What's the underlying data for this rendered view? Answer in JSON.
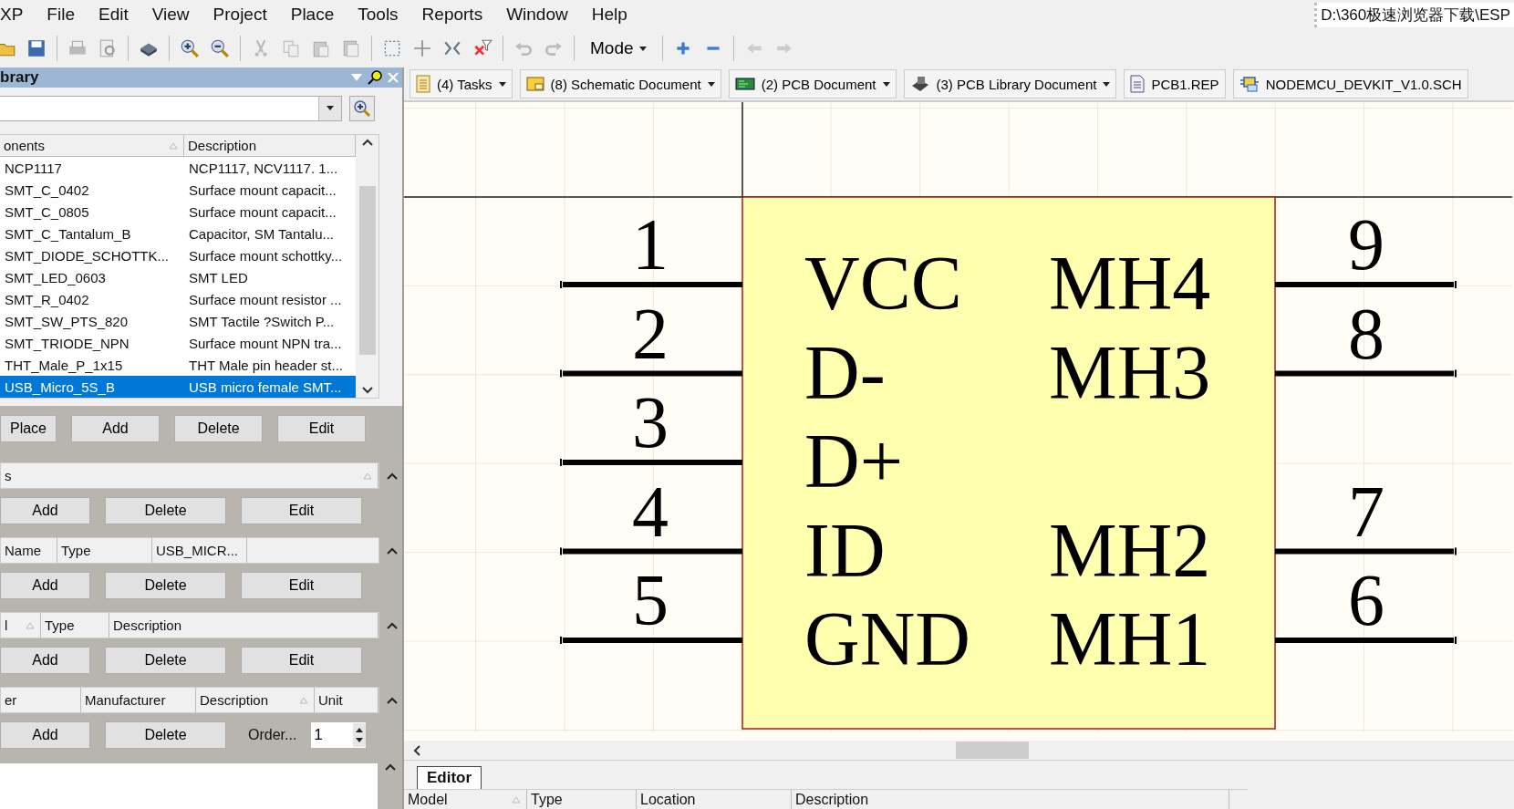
{
  "menu": [
    {
      "label": "XP"
    },
    {
      "label": "File"
    },
    {
      "label": "Edit"
    },
    {
      "label": "View"
    },
    {
      "label": "Project"
    },
    {
      "label": "Place"
    },
    {
      "label": "Tools"
    },
    {
      "label": "Reports"
    },
    {
      "label": "Window"
    },
    {
      "label": "Help"
    }
  ],
  "path": "D:\\360极速浏览器下载\\ESP",
  "toolbar": {
    "mode_button": "Mode"
  },
  "panel": {
    "title": "brary",
    "components": {
      "columns": [
        {
          "label": "onents",
          "sorted": true
        },
        {
          "label": "Description",
          "sorted": false
        }
      ],
      "rows": [
        {
          "name": "NCP1117",
          "description": "NCP1117, NCV1117. 1...",
          "selected": false
        },
        {
          "name": "SMT_C_0402",
          "description": "Surface mount capacit...",
          "selected": false
        },
        {
          "name": "SMT_C_0805",
          "description": "Surface mount capacit...",
          "selected": false
        },
        {
          "name": "SMT_C_Tantalum_B",
          "description": "Capacitor, SM Tantalu...",
          "selected": false
        },
        {
          "name": "SMT_DIODE_SCHOTTK...",
          "description": "Surface mount schottky...",
          "selected": false
        },
        {
          "name": "SMT_LED_0603",
          "description": "SMT LED",
          "selected": false
        },
        {
          "name": "SMT_R_0402",
          "description": "Surface mount resistor ...",
          "selected": false
        },
        {
          "name": "SMT_SW_PTS_820",
          "description": "SMT Tactile ?Switch P...",
          "selected": false
        },
        {
          "name": "SMT_TRIODE_NPN",
          "description": "Surface mount NPN tra...",
          "selected": false
        },
        {
          "name": "THT_Male_P_1x15",
          "description": "THT Male pin header st...",
          "selected": false
        },
        {
          "name": "USB_Micro_5S_B",
          "description": "USB micro female SMT...",
          "selected": true
        }
      ]
    },
    "component_buttons": [
      "Place",
      "Add",
      "Delete",
      "Edit"
    ],
    "sections": [
      {
        "columns": [
          {
            "label": "s",
            "sorted": true
          }
        ],
        "buttons": [
          "Add",
          "Delete",
          "Edit"
        ]
      },
      {
        "columns": [
          {
            "label": "Name",
            "sorted": false
          },
          {
            "label": "Type",
            "sorted": false
          },
          {
            "label": "USB_MICR...",
            "sorted": false
          }
        ],
        "buttons": [
          "Add",
          "Delete",
          "Edit"
        ]
      },
      {
        "columns": [
          {
            "label": "l",
            "sorted": true
          },
          {
            "label": "Type",
            "sorted": false
          },
          {
            "label": "Description",
            "sorted": false
          }
        ],
        "buttons": [
          "Add",
          "Delete",
          "Edit"
        ]
      },
      {
        "columns": [
          {
            "label": "er",
            "sorted": false
          },
          {
            "label": "Manufacturer",
            "sorted": false
          },
          {
            "label": "Description",
            "sorted": true
          },
          {
            "label": "Unit",
            "sorted": false
          }
        ],
        "buttons": [
          "Add",
          "Delete"
        ],
        "order": {
          "label": "Order...",
          "value": "1"
        }
      }
    ]
  },
  "doc_tabs": [
    {
      "label": "(4) Tasks",
      "kind": "tasks",
      "dropdown": true
    },
    {
      "label": "(8) Schematic Document",
      "kind": "schematic",
      "dropdown": true
    },
    {
      "label": "(2) PCB Document",
      "kind": "pcb",
      "dropdown": true
    },
    {
      "label": "(3) PCB Library Document",
      "kind": "pcblib",
      "dropdown": true
    },
    {
      "label": "PCB1.REP",
      "kind": "report",
      "dropdown": false
    },
    {
      "label": "NODEMCU_DEVKIT_V1.0.SCH",
      "kind": "schlib",
      "dropdown": false
    }
  ],
  "schematic": {
    "rows": [
      {
        "left": {
          "number": "1",
          "name": "VCC"
        },
        "right": {
          "number": "9",
          "name": "MH4"
        }
      },
      {
        "left": {
          "number": "2",
          "name": "D-"
        },
        "right": {
          "number": "8",
          "name": "MH3"
        }
      },
      {
        "left": {
          "number": "3",
          "name": "D+"
        }
      },
      {
        "left": {
          "number": "4",
          "name": "ID"
        },
        "right": {
          "number": "7",
          "name": "MH2"
        }
      },
      {
        "left": {
          "number": "5",
          "name": "GND"
        },
        "right": {
          "number": "6",
          "name": "MH1"
        }
      }
    ]
  },
  "editor_tab": "Editor",
  "bottom_table": {
    "columns": [
      {
        "label": "Model",
        "sorted": true
      },
      {
        "label": "Type",
        "sorted": false
      },
      {
        "label": "Location",
        "sorted": false
      },
      {
        "label": "Description",
        "sorted": false
      }
    ]
  }
}
